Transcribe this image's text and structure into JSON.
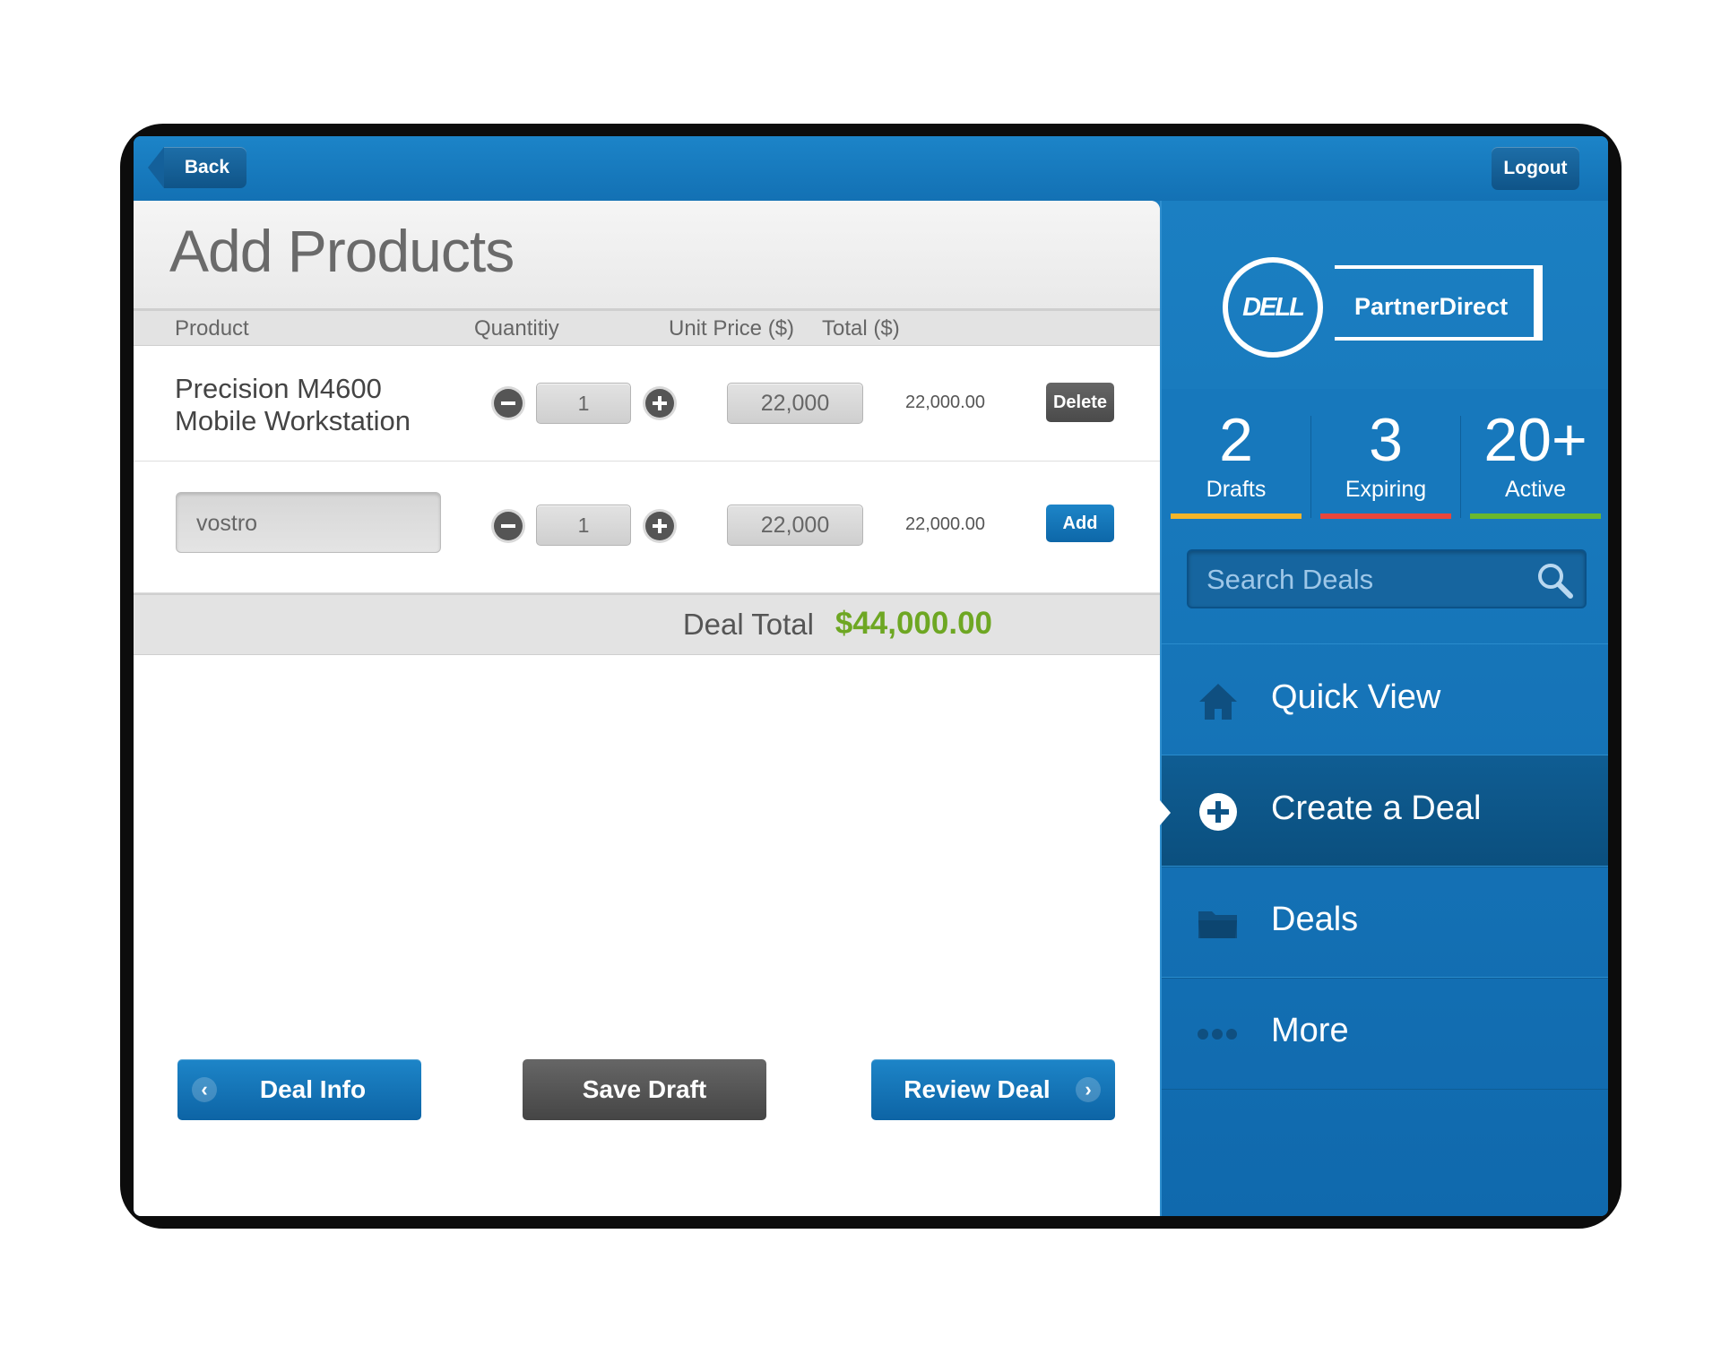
{
  "topbar": {
    "back_label": "Back",
    "logout_label": "Logout"
  },
  "main": {
    "title": "Add Products",
    "columns": [
      "Product",
      "Quantitiy",
      "Unit Price ($)",
      "Total ($)"
    ],
    "rows": [
      {
        "product_line1": "Precision M4600",
        "product_line2": "Mobile Workstation",
        "quantity": "1",
        "unit_price": "22,000",
        "total": "22,000.00",
        "action": "Delete"
      },
      {
        "product_input": "vostro",
        "quantity": "1",
        "unit_price": "22,000",
        "total": "22,000.00",
        "action": "Add"
      }
    ],
    "deal_total_label": "Deal Total",
    "deal_total_value": "$44,000.00",
    "buttons": {
      "deal_info": "Deal Info",
      "save_draft": "Save Draft",
      "review_deal": "Review Deal"
    }
  },
  "sidebar": {
    "brand": {
      "logo_text": "DELL",
      "product": "PartnerDirect"
    },
    "stats": [
      {
        "number": "2",
        "label": "Drafts",
        "color": "#f4b52a"
      },
      {
        "number": "3",
        "label": "Expiring",
        "color": "#e8463c"
      },
      {
        "number": "20+",
        "label": "Active",
        "color": "#6ab82e"
      }
    ],
    "search_placeholder": "Search Deals",
    "nav": [
      {
        "label": "Quick View",
        "icon": "home-icon"
      },
      {
        "label": "Create a Deal",
        "icon": "plus-circle-icon",
        "active": true
      },
      {
        "label": "Deals",
        "icon": "folder-icon"
      },
      {
        "label": "More",
        "icon": "more-dots-icon"
      }
    ]
  }
}
